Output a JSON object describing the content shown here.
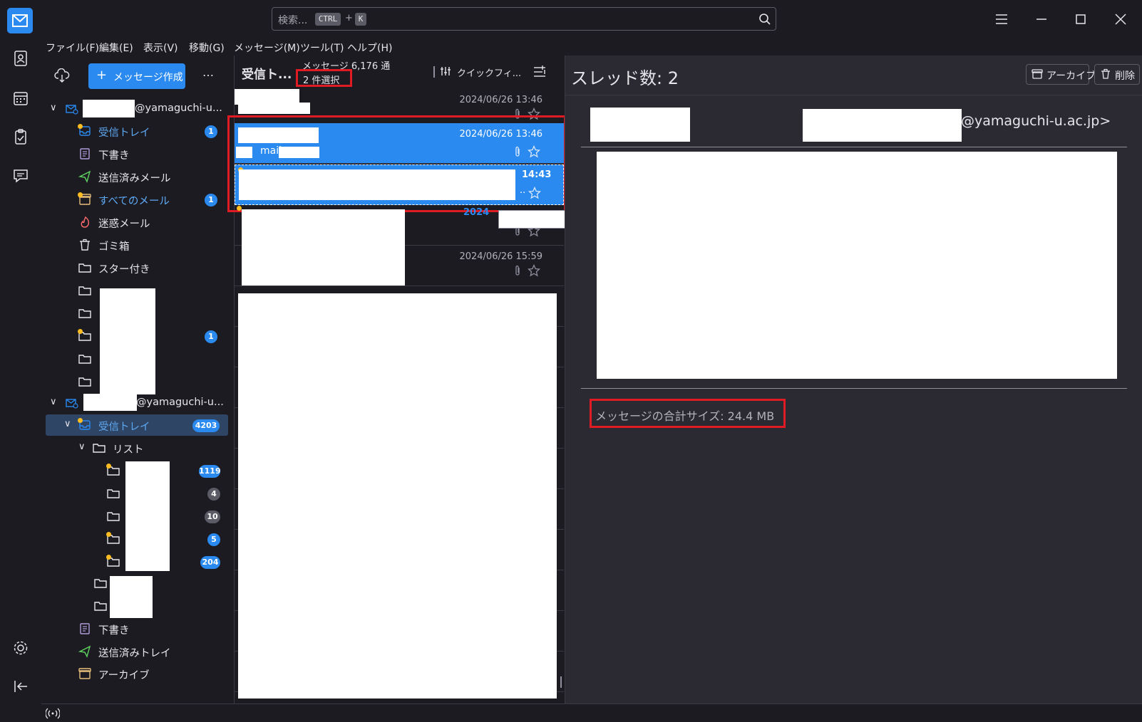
{
  "search": {
    "placeholder": "検索...",
    "kbd_ctrl": "CTRL",
    "kbd_plus": "+",
    "kbd_k": "K"
  },
  "menu": [
    "ファイル(F)",
    "編集(E)",
    "表示(V)",
    "移動(G)",
    "メッセージ(M)",
    "ツール(T)",
    "ヘルプ(H)"
  ],
  "folders": {
    "compose_label": "メッセージ作成",
    "more": "…",
    "account1": {
      "domain": "@yamaguchi-u...",
      "items": [
        {
          "label": "受信トレイ",
          "badge": "1"
        },
        {
          "label": "下書き"
        },
        {
          "label": "送信済みメール"
        },
        {
          "label": "すべてのメール",
          "badge": "1"
        },
        {
          "label": "迷惑メール"
        },
        {
          "label": "ゴミ箱"
        },
        {
          "label": "スター付き"
        }
      ],
      "custom_badge": "1"
    },
    "account2": {
      "domain": "@yamaguchi-u...",
      "inbox": {
        "label": "受信トレイ",
        "badge": "4203"
      },
      "list": {
        "label": "リスト"
      },
      "list_badges": [
        "1119",
        "4",
        "10",
        "5",
        "204"
      ],
      "items": [
        {
          "label": "下書き"
        },
        {
          "label": "送信済みトレイ"
        },
        {
          "label": "アーカイブ"
        }
      ]
    }
  },
  "thread": {
    "folder_title": "受信ト...",
    "count": "メッセージ 6,176 通",
    "selected": "2 件選択",
    "quick_filter": "クイックフィ...",
    "rows": [
      {
        "date": "2024/06/26 13:46"
      },
      {
        "date": "2024/06/26 13:46",
        "preview": "mail"
      },
      {
        "date": "14:43",
        "ellipsis": ".."
      },
      {
        "date": "2024"
      },
      {
        "date": "2024/06/26 15:59"
      }
    ]
  },
  "reading": {
    "thread_count": "スレッド数: 2",
    "archive": "アーカイブ",
    "delete": "削除",
    "sender_domain": "@yamaguchi-u.ac.jp>",
    "total_size": "メッセージの合計サイズ: 24.4 MB"
  },
  "colors": {
    "accent": "#2a8af0",
    "highlight": "#e01b24",
    "unread": "#ffbd1f"
  }
}
